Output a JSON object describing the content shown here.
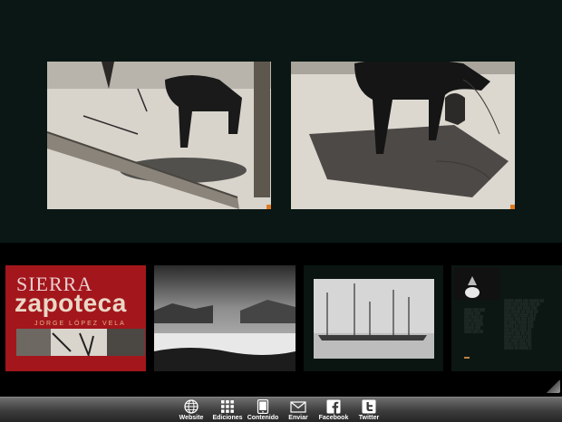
{
  "cover": {
    "title_top": "SIERRA",
    "title_main": "zapoteca",
    "author": "JORGE LÓPEZ VELA"
  },
  "toolbar": {
    "items": [
      {
        "label": "Website",
        "icon": "globe-icon"
      },
      {
        "label": "Ediciones",
        "icon": "grid-icon"
      },
      {
        "label": "Contenido",
        "icon": "tablet-icon"
      },
      {
        "label": "Enviar",
        "icon": "envelope-icon"
      },
      {
        "label": "Facebook",
        "icon": "facebook-icon"
      },
      {
        "label": "Twitter",
        "icon": "twitter-icon"
      }
    ]
  },
  "colors": {
    "viewer_bg": "#0a1714",
    "cover_red": "#a3161c",
    "corner_marker": "#e07a20"
  }
}
